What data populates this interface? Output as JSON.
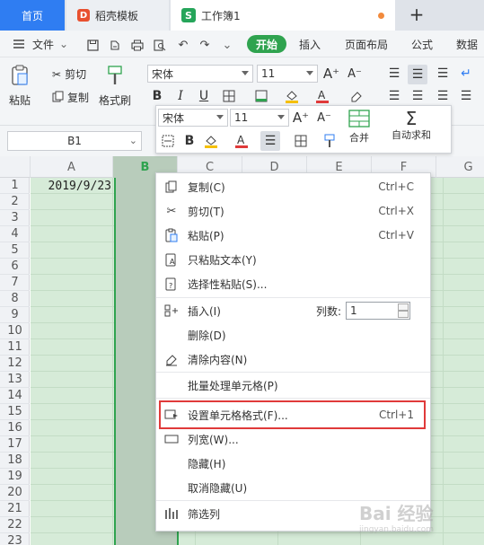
{
  "tabs": {
    "home": "首页",
    "docer": "稻壳模板",
    "workbook": "工作簿1",
    "docer_logo": "D",
    "sheet_logo": "S",
    "new_tab": "+"
  },
  "menubar": {
    "file": "文件",
    "items": [
      "开始",
      "插入",
      "页面布局",
      "公式",
      "数据"
    ]
  },
  "ribbon": {
    "paste": "粘贴",
    "cut": "剪切",
    "copy": "复制",
    "format_painter": "格式刷",
    "font": "宋体",
    "size": "11",
    "bold": "B",
    "italic": "I",
    "underline": "U"
  },
  "namebox": "B1",
  "mini_toolbar": {
    "font": "宋体",
    "size": "11",
    "bold": "B",
    "merge": "合并",
    "autosum": "自动求和"
  },
  "columns": [
    "A",
    "B",
    "C",
    "D",
    "E",
    "F",
    "G"
  ],
  "rows": [
    "1",
    "2",
    "3",
    "4",
    "5",
    "6",
    "7",
    "8",
    "9",
    "10",
    "11",
    "12",
    "13",
    "14",
    "15",
    "16",
    "17",
    "18",
    "19",
    "20",
    "21",
    "22",
    "23"
  ],
  "cell_a1": "2019/9/23",
  "context_menu": {
    "items": [
      {
        "label": "复制(C)",
        "shortcut": "Ctrl+C",
        "icon": "copy-icon"
      },
      {
        "label": "剪切(T)",
        "shortcut": "Ctrl+X",
        "icon": "scissors-icon"
      },
      {
        "label": "粘贴(P)",
        "shortcut": "Ctrl+V",
        "icon": "paste-icon"
      },
      {
        "label": "只粘贴文本(Y)",
        "shortcut": "",
        "icon": "paste-text-icon"
      },
      {
        "label": "选择性粘贴(S)...",
        "shortcut": "",
        "icon": "paste-special-icon"
      },
      {
        "label": "插入(I)",
        "shortcut": "",
        "icon": "insert-icon"
      },
      {
        "label": "删除(D)",
        "shortcut": "",
        "icon": ""
      },
      {
        "label": "清除内容(N)",
        "shortcut": "",
        "icon": "eraser-icon"
      },
      {
        "label": "批量处理单元格(P)",
        "shortcut": "",
        "icon": ""
      },
      {
        "label": "设置单元格格式(F)...",
        "shortcut": "Ctrl+1",
        "icon": "format-cells-icon"
      },
      {
        "label": "列宽(W)...",
        "shortcut": "",
        "icon": "column-width-icon"
      },
      {
        "label": "隐藏(H)",
        "shortcut": "",
        "icon": ""
      },
      {
        "label": "取消隐藏(U)",
        "shortcut": "",
        "icon": ""
      },
      {
        "label": "筛选列",
        "shortcut": "",
        "icon": "filter-columns-icon"
      }
    ],
    "columns_label": "列数:",
    "columns_value": "1"
  },
  "watermark": "Bai 经验",
  "watermark_sub": "jingyan.baidu.com",
  "colors": {
    "accent_blue": "#2f7df2",
    "accent_green": "#2fa34f",
    "highlight_red": "#e03a3a",
    "sheet_bg": "#d6ebd8"
  }
}
